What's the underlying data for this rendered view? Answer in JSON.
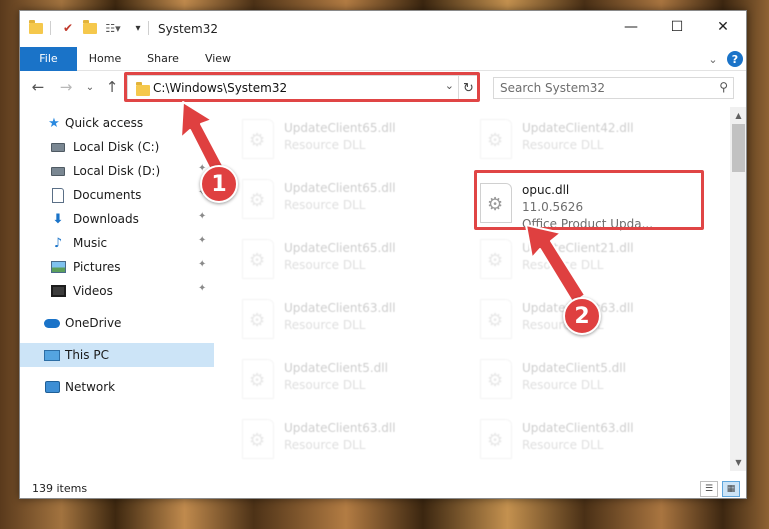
{
  "window": {
    "title": "System32",
    "minimize": "—",
    "maximize": "☐",
    "close": "✕"
  },
  "ribbon": {
    "tabs": [
      "File",
      "Home",
      "Share",
      "View"
    ],
    "collapse": "⌄",
    "help": "?"
  },
  "nav": {
    "back": "←",
    "forward": "→",
    "recent": "⌄",
    "up": "↑"
  },
  "address": {
    "path": "C:\\Windows\\System32",
    "dropdown": "⌄",
    "refresh": "↻"
  },
  "search": {
    "placeholder": "Search System32"
  },
  "sidebar": {
    "items": [
      {
        "label": "Quick access",
        "icon": "star-icon"
      },
      {
        "label": "Local Disk (C:)",
        "icon": "drive-icon",
        "pinned": true
      },
      {
        "label": "Local Disk (D:)",
        "icon": "drive-icon",
        "pinned": true
      },
      {
        "label": "Documents",
        "icon": "documents-icon",
        "pinned": true
      },
      {
        "label": "Downloads",
        "icon": "downloads-icon",
        "pinned": true
      },
      {
        "label": "Music",
        "icon": "music-icon",
        "pinned": true
      },
      {
        "label": "Pictures",
        "icon": "pictures-icon",
        "pinned": true
      },
      {
        "label": "Videos",
        "icon": "videos-icon",
        "pinned": true
      },
      {
        "label": "OneDrive",
        "icon": "cloud-icon"
      },
      {
        "label": "This PC",
        "icon": "monitor-icon",
        "selected": true
      },
      {
        "label": "Network",
        "icon": "network-icon"
      }
    ],
    "pin_glyph": "📌"
  },
  "files": {
    "left_column": [
      {
        "name": "UpdateClient65.dll",
        "desc": "Resource DLL"
      },
      {
        "name": "UpdateClient65.dll",
        "desc": "Resource DLL"
      },
      {
        "name": "UpdateClient65.dll",
        "desc": "Resource DLL"
      },
      {
        "name": "UpdateClient63.dll",
        "desc": "Resource DLL"
      },
      {
        "name": "UpdateClient5.dll",
        "desc": "Resource DLL"
      },
      {
        "name": "UpdateClient63.dll",
        "desc": "Resource DLL"
      }
    ],
    "right_column": [
      {
        "name": "UpdateClient42.dll",
        "desc": "Resource DLL"
      },
      {
        "name": "UpdateClient21.dll",
        "desc": "Resource DLL"
      },
      {
        "name": "UpdateClient63.dll",
        "desc": "Resource DLL"
      },
      {
        "name": "UpdateClient5.dll",
        "desc": "Resource DLL"
      },
      {
        "name": "UpdateClient63.dll",
        "desc": "Resource DLL"
      }
    ],
    "highlighted": {
      "name": "opuc.dll",
      "version": "11.0.5626",
      "desc": "Office Product Upda..."
    }
  },
  "status": {
    "count": "139 items"
  },
  "callouts": [
    "1",
    "2"
  ],
  "colors": {
    "accent": "#1a73c8",
    "highlight": "#e04545",
    "selected": "#cce4f7"
  }
}
